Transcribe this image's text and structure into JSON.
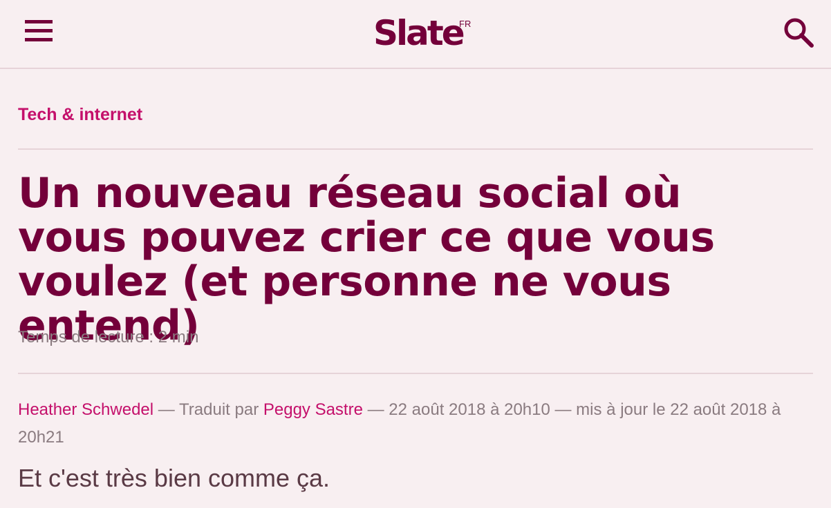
{
  "header": {
    "logo": "Slate",
    "logo_sup": "FR"
  },
  "article": {
    "category": "Tech & internet",
    "title": "Un nouveau réseau social où vous pouvez crier ce que vous voulez (et personne ne vous entend)",
    "reading_time": "Temps de lecture : 2 min",
    "author": "Heather Schwedel",
    "translated_by_label": " — Traduit par ",
    "translator": "Peggy Sastre",
    "date_text": " — 22 août 2018 à 20h10 — mis à jour le 22 août 2018 à 20h21",
    "subtitle": "Et c'est très bien comme ça."
  },
  "colors": {
    "background": "#f8eff1",
    "brand": "#74003a",
    "accent": "#c4106b",
    "muted": "#8a7b80"
  },
  "icons": {
    "menu": "hamburger-icon",
    "search": "search-icon"
  }
}
